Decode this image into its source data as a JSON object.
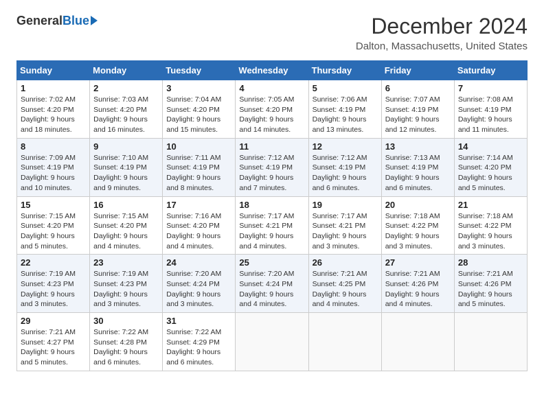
{
  "header": {
    "logo_general": "General",
    "logo_blue": "Blue",
    "month_title": "December 2024",
    "location": "Dalton, Massachusetts, United States"
  },
  "days_of_week": [
    "Sunday",
    "Monday",
    "Tuesday",
    "Wednesday",
    "Thursday",
    "Friday",
    "Saturday"
  ],
  "weeks": [
    [
      {
        "day": "1",
        "sunrise": "Sunrise: 7:02 AM",
        "sunset": "Sunset: 4:20 PM",
        "daylight": "Daylight: 9 hours and 18 minutes."
      },
      {
        "day": "2",
        "sunrise": "Sunrise: 7:03 AM",
        "sunset": "Sunset: 4:20 PM",
        "daylight": "Daylight: 9 hours and 16 minutes."
      },
      {
        "day": "3",
        "sunrise": "Sunrise: 7:04 AM",
        "sunset": "Sunset: 4:20 PM",
        "daylight": "Daylight: 9 hours and 15 minutes."
      },
      {
        "day": "4",
        "sunrise": "Sunrise: 7:05 AM",
        "sunset": "Sunset: 4:20 PM",
        "daylight": "Daylight: 9 hours and 14 minutes."
      },
      {
        "day": "5",
        "sunrise": "Sunrise: 7:06 AM",
        "sunset": "Sunset: 4:19 PM",
        "daylight": "Daylight: 9 hours and 13 minutes."
      },
      {
        "day": "6",
        "sunrise": "Sunrise: 7:07 AM",
        "sunset": "Sunset: 4:19 PM",
        "daylight": "Daylight: 9 hours and 12 minutes."
      },
      {
        "day": "7",
        "sunrise": "Sunrise: 7:08 AM",
        "sunset": "Sunset: 4:19 PM",
        "daylight": "Daylight: 9 hours and 11 minutes."
      }
    ],
    [
      {
        "day": "8",
        "sunrise": "Sunrise: 7:09 AM",
        "sunset": "Sunset: 4:19 PM",
        "daylight": "Daylight: 9 hours and 10 minutes."
      },
      {
        "day": "9",
        "sunrise": "Sunrise: 7:10 AM",
        "sunset": "Sunset: 4:19 PM",
        "daylight": "Daylight: 9 hours and 9 minutes."
      },
      {
        "day": "10",
        "sunrise": "Sunrise: 7:11 AM",
        "sunset": "Sunset: 4:19 PM",
        "daylight": "Daylight: 9 hours and 8 minutes."
      },
      {
        "day": "11",
        "sunrise": "Sunrise: 7:12 AM",
        "sunset": "Sunset: 4:19 PM",
        "daylight": "Daylight: 9 hours and 7 minutes."
      },
      {
        "day": "12",
        "sunrise": "Sunrise: 7:12 AM",
        "sunset": "Sunset: 4:19 PM",
        "daylight": "Daylight: 9 hours and 6 minutes."
      },
      {
        "day": "13",
        "sunrise": "Sunrise: 7:13 AM",
        "sunset": "Sunset: 4:19 PM",
        "daylight": "Daylight: 9 hours and 6 minutes."
      },
      {
        "day": "14",
        "sunrise": "Sunrise: 7:14 AM",
        "sunset": "Sunset: 4:20 PM",
        "daylight": "Daylight: 9 hours and 5 minutes."
      }
    ],
    [
      {
        "day": "15",
        "sunrise": "Sunrise: 7:15 AM",
        "sunset": "Sunset: 4:20 PM",
        "daylight": "Daylight: 9 hours and 5 minutes."
      },
      {
        "day": "16",
        "sunrise": "Sunrise: 7:15 AM",
        "sunset": "Sunset: 4:20 PM",
        "daylight": "Daylight: 9 hours and 4 minutes."
      },
      {
        "day": "17",
        "sunrise": "Sunrise: 7:16 AM",
        "sunset": "Sunset: 4:20 PM",
        "daylight": "Daylight: 9 hours and 4 minutes."
      },
      {
        "day": "18",
        "sunrise": "Sunrise: 7:17 AM",
        "sunset": "Sunset: 4:21 PM",
        "daylight": "Daylight: 9 hours and 4 minutes."
      },
      {
        "day": "19",
        "sunrise": "Sunrise: 7:17 AM",
        "sunset": "Sunset: 4:21 PM",
        "daylight": "Daylight: 9 hours and 3 minutes."
      },
      {
        "day": "20",
        "sunrise": "Sunrise: 7:18 AM",
        "sunset": "Sunset: 4:22 PM",
        "daylight": "Daylight: 9 hours and 3 minutes."
      },
      {
        "day": "21",
        "sunrise": "Sunrise: 7:18 AM",
        "sunset": "Sunset: 4:22 PM",
        "daylight": "Daylight: 9 hours and 3 minutes."
      }
    ],
    [
      {
        "day": "22",
        "sunrise": "Sunrise: 7:19 AM",
        "sunset": "Sunset: 4:23 PM",
        "daylight": "Daylight: 9 hours and 3 minutes."
      },
      {
        "day": "23",
        "sunrise": "Sunrise: 7:19 AM",
        "sunset": "Sunset: 4:23 PM",
        "daylight": "Daylight: 9 hours and 3 minutes."
      },
      {
        "day": "24",
        "sunrise": "Sunrise: 7:20 AM",
        "sunset": "Sunset: 4:24 PM",
        "daylight": "Daylight: 9 hours and 3 minutes."
      },
      {
        "day": "25",
        "sunrise": "Sunrise: 7:20 AM",
        "sunset": "Sunset: 4:24 PM",
        "daylight": "Daylight: 9 hours and 4 minutes."
      },
      {
        "day": "26",
        "sunrise": "Sunrise: 7:21 AM",
        "sunset": "Sunset: 4:25 PM",
        "daylight": "Daylight: 9 hours and 4 minutes."
      },
      {
        "day": "27",
        "sunrise": "Sunrise: 7:21 AM",
        "sunset": "Sunset: 4:26 PM",
        "daylight": "Daylight: 9 hours and 4 minutes."
      },
      {
        "day": "28",
        "sunrise": "Sunrise: 7:21 AM",
        "sunset": "Sunset: 4:26 PM",
        "daylight": "Daylight: 9 hours and 5 minutes."
      }
    ],
    [
      {
        "day": "29",
        "sunrise": "Sunrise: 7:21 AM",
        "sunset": "Sunset: 4:27 PM",
        "daylight": "Daylight: 9 hours and 5 minutes."
      },
      {
        "day": "30",
        "sunrise": "Sunrise: 7:22 AM",
        "sunset": "Sunset: 4:28 PM",
        "daylight": "Daylight: 9 hours and 6 minutes."
      },
      {
        "day": "31",
        "sunrise": "Sunrise: 7:22 AM",
        "sunset": "Sunset: 4:29 PM",
        "daylight": "Daylight: 9 hours and 6 minutes."
      },
      null,
      null,
      null,
      null
    ]
  ]
}
